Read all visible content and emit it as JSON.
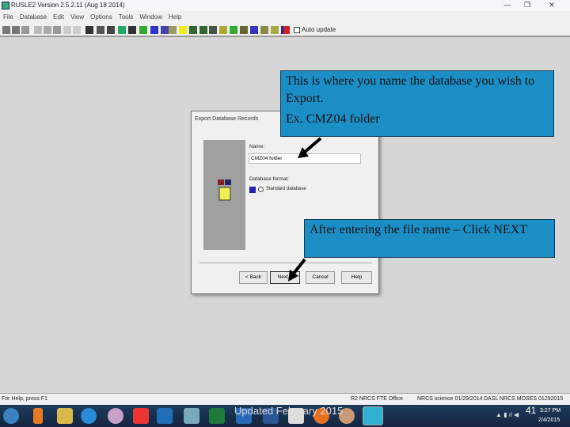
{
  "window": {
    "title": "RUSLE2 Version 2.5.2.11 (Aug 18 2014)",
    "min": "—",
    "max": "❐",
    "close": "✕"
  },
  "menu": [
    "File",
    "Database",
    "Edit",
    "View",
    "Options",
    "Tools",
    "Window",
    "Help"
  ],
  "toolbar": {
    "autoupdate_label": "Auto update"
  },
  "dialog": {
    "title": "Export Database Records",
    "name_label": "Name:",
    "name_value": "CMZ04 folder",
    "format_label": "Database format:",
    "format_option": "Standard database",
    "back": "< Back",
    "next": "Next >",
    "cancel": "Cancel",
    "help": "Help"
  },
  "callouts": {
    "top": "This is where you name the database you wish to Export.",
    "top_example": "Ex. CMZ04 folder",
    "bottom": "After entering the file name – Click NEXT"
  },
  "statusbar": {
    "help": "For Help, press F1",
    "items": [
      "R2 NRCS FTE Office",
      "NRCS science 01/29/2014",
      "DASL NRCS MOSES 01292015"
    ]
  },
  "taskbar": {
    "overlay": "Updated February 2015",
    "page": "41",
    "time": "3:27 PM",
    "date": "2/4/2015"
  },
  "colors": {
    "callout": "#1c8ec6",
    "taskbar": "#1d3a5c"
  }
}
